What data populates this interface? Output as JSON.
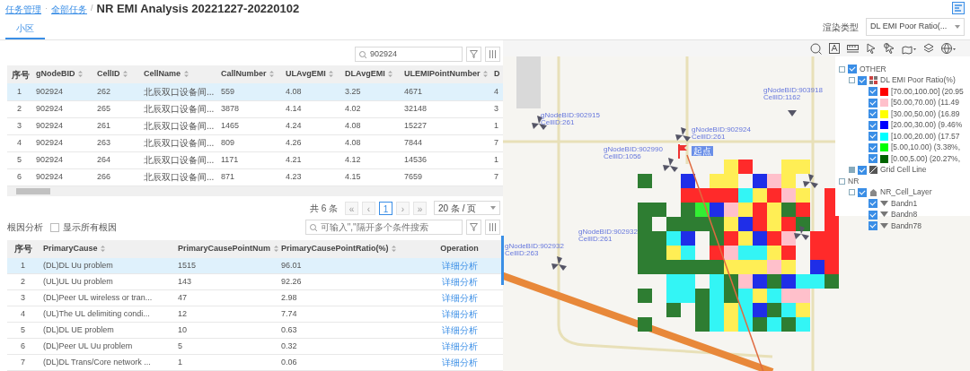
{
  "breadcrumb": {
    "links": [
      "任务管理",
      "全部任务"
    ],
    "link_separator": "·",
    "separator": "/",
    "title": "NR EMI Analysis 20221227-20220102"
  },
  "tabs": [
    {
      "label": "小区",
      "selected": true
    }
  ],
  "render_type": {
    "label": "渲染类型",
    "value": "DL EMI Poor Ratio(..."
  },
  "cell_table": {
    "search": {
      "value": "902924"
    },
    "columns": [
      "序号",
      "gNodeBID",
      "CellID",
      "CellName",
      "CallNumber",
      "ULAvgEMI",
      "DLAvgEMI",
      "ULEMIPointNumber",
      "D"
    ],
    "rows": [
      {
        "selected": true,
        "cells": [
          "1",
          "902924",
          "262",
          "北辰双口设备间...",
          "559",
          "4.08",
          "3.25",
          "4671",
          "4"
        ]
      },
      {
        "selected": false,
        "cells": [
          "2",
          "902924",
          "265",
          "北辰双口设备间...",
          "3878",
          "4.14",
          "4.02",
          "32148",
          "3"
        ]
      },
      {
        "selected": false,
        "cells": [
          "3",
          "902924",
          "261",
          "北辰双口设备间...",
          "1465",
          "4.24",
          "4.08",
          "15227",
          "1"
        ]
      },
      {
        "selected": false,
        "cells": [
          "4",
          "902924",
          "263",
          "北辰双口设备间...",
          "809",
          "4.26",
          "4.08",
          "7844",
          "7"
        ]
      },
      {
        "selected": false,
        "cells": [
          "5",
          "902924",
          "264",
          "北辰双口设备间...",
          "1171",
          "4.21",
          "4.12",
          "14536",
          "1"
        ]
      },
      {
        "selected": false,
        "cells": [
          "6",
          "902924",
          "266",
          "北辰双口设备间...",
          "871",
          "4.23",
          "4.15",
          "7659",
          "7"
        ]
      }
    ]
  },
  "pager": {
    "total": "共 6 条",
    "buttons": [
      {
        "label": "«",
        "selected": false,
        "disabled": true
      },
      {
        "label": "‹",
        "selected": false,
        "disabled": true
      },
      {
        "label": "1",
        "selected": true,
        "disabled": false
      },
      {
        "label": "›",
        "selected": false,
        "disabled": true
      },
      {
        "label": "»",
        "selected": false,
        "disabled": true
      }
    ],
    "page_size": "20 条 / 页"
  },
  "cause_section": {
    "title": "根因分析",
    "show_all": {
      "label": "显示所有根因",
      "checked": false
    },
    "search": {
      "placeholder": "可输入\",\"隔开多个条件搜索"
    },
    "columns": [
      "序号",
      "PrimaryCause",
      "PrimaryCausePointNum",
      "PrimaryCausePointRatio(%)",
      "Operation"
    ],
    "rows": [
      {
        "selected": true,
        "cells": [
          "1",
          "(DL)DL Uu problem",
          "1515",
          "96.01"
        ],
        "action": "详细分析"
      },
      {
        "selected": false,
        "cells": [
          "2",
          "(UL)UL Uu problem",
          "143",
          "92.26"
        ],
        "action": "详细分析"
      },
      {
        "selected": false,
        "cells": [
          "3",
          "(DL)Peer UL wireless or tran...",
          "47",
          "2.98"
        ],
        "action": "详细分析"
      },
      {
        "selected": false,
        "cells": [
          "4",
          "(UL)The UL delimiting condi...",
          "12",
          "7.74"
        ],
        "action": "详细分析"
      },
      {
        "selected": false,
        "cells": [
          "5",
          "(DL)DL UE problem",
          "10",
          "0.63"
        ],
        "action": "详细分析"
      },
      {
        "selected": false,
        "cells": [
          "6",
          "(DL)Peer UL Uu problem",
          "5",
          "0.32"
        ],
        "action": "详细分析"
      },
      {
        "selected": false,
        "cells": [
          "7",
          "(DL)DL Trans/Core network ...",
          "1",
          "0.06"
        ],
        "action": "详细分析"
      }
    ]
  },
  "map": {
    "site_labels": [
      {
        "lines": [
          "gNodeBID:902915",
          "CellID:261"
        ]
      },
      {
        "lines": [
          "gNodeBID:903918",
          "CellID:1162"
        ]
      },
      {
        "lines": [
          "gNodeBID:902924",
          "CellID:261"
        ]
      },
      {
        "lines": [
          "gNodeBID:902990",
          "CellID:1056"
        ]
      },
      {
        "lines": [
          "gNodeBID:902932",
          "CellID:263"
        ]
      },
      {
        "lines": [
          "gNodeBID:902932",
          "CellID:261"
        ]
      }
    ],
    "start_label": "起点",
    "legend": [
      {
        "label": "OTHER",
        "expanded": true,
        "checked": true,
        "children": [
          {
            "label": "DL EMI Poor Ratio(%)",
            "kind": "ratio-layer",
            "expanded": true,
            "checked": true,
            "children": [
              {
                "label": "[70.00,100.00] (20.95",
                "checked": true,
                "color": "#ff0000"
              },
              {
                "label": "[50.00,70.00) (11.49",
                "checked": true,
                "color": "#ffc0cb"
              },
              {
                "label": "[30.00,50.00) (16.89",
                "checked": true,
                "color": "#ffff00"
              },
              {
                "label": "[20.00,30.00) (9.46%",
                "checked": true,
                "color": "#0000ff"
              },
              {
                "label": "[10.00,20.00) (17.57",
                "checked": true,
                "color": "#00ffff"
              },
              {
                "label": "[5.00,10.00) (3.38%,",
                "checked": true,
                "color": "#00ff00"
              },
              {
                "label": "[0.00,5.00) (20.27%,",
                "checked": true,
                "color": "#006400"
              }
            ]
          },
          {
            "label": "Grid Cell Line",
            "kind": "line-layer",
            "expanded": false,
            "checked": true
          }
        ]
      },
      {
        "label": "NR",
        "expanded": true,
        "children": [
          {
            "label": "NR_Cell_Layer",
            "kind": "cell-layer",
            "expanded": true,
            "checked": true,
            "children": [
              {
                "label": "Bandn1",
                "kind": "band",
                "checked": true
              },
              {
                "label": "Bandn8",
                "kind": "band",
                "checked": true
              },
              {
                "label": "Bandn78",
                "kind": "band",
                "checked": true
              }
            ]
          }
        ]
      }
    ]
  }
}
